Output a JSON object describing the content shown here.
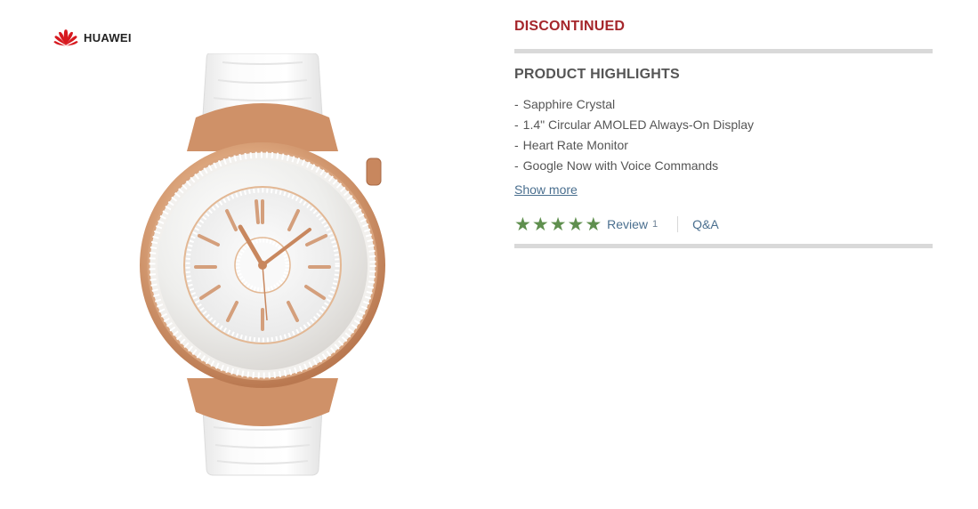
{
  "brand": {
    "name": "HUAWEI",
    "logo_icon": "huawei-petal-logo",
    "logo_color": "#d7191f"
  },
  "product": {
    "image_alt": "Huawei Watch Elegant Jewel with white crocodile leather strap and rose gold case"
  },
  "status": {
    "label": "DISCONTINUED",
    "color": "#a5262b"
  },
  "highlights": {
    "title": "PRODUCT HIGHLIGHTS",
    "items": [
      "Sapphire Crystal",
      "1.4\" Circular AMOLED Always-On Display",
      "Heart Rate Monitor",
      "Google Now with Voice Commands"
    ],
    "show_more_label": "Show more"
  },
  "reviews": {
    "rating": 5,
    "max_rating": 5,
    "star_icon": "star-icon",
    "star_color": "#5f8f4e",
    "review_label": "Review",
    "review_count": "1",
    "qa_label": "Q&A"
  }
}
